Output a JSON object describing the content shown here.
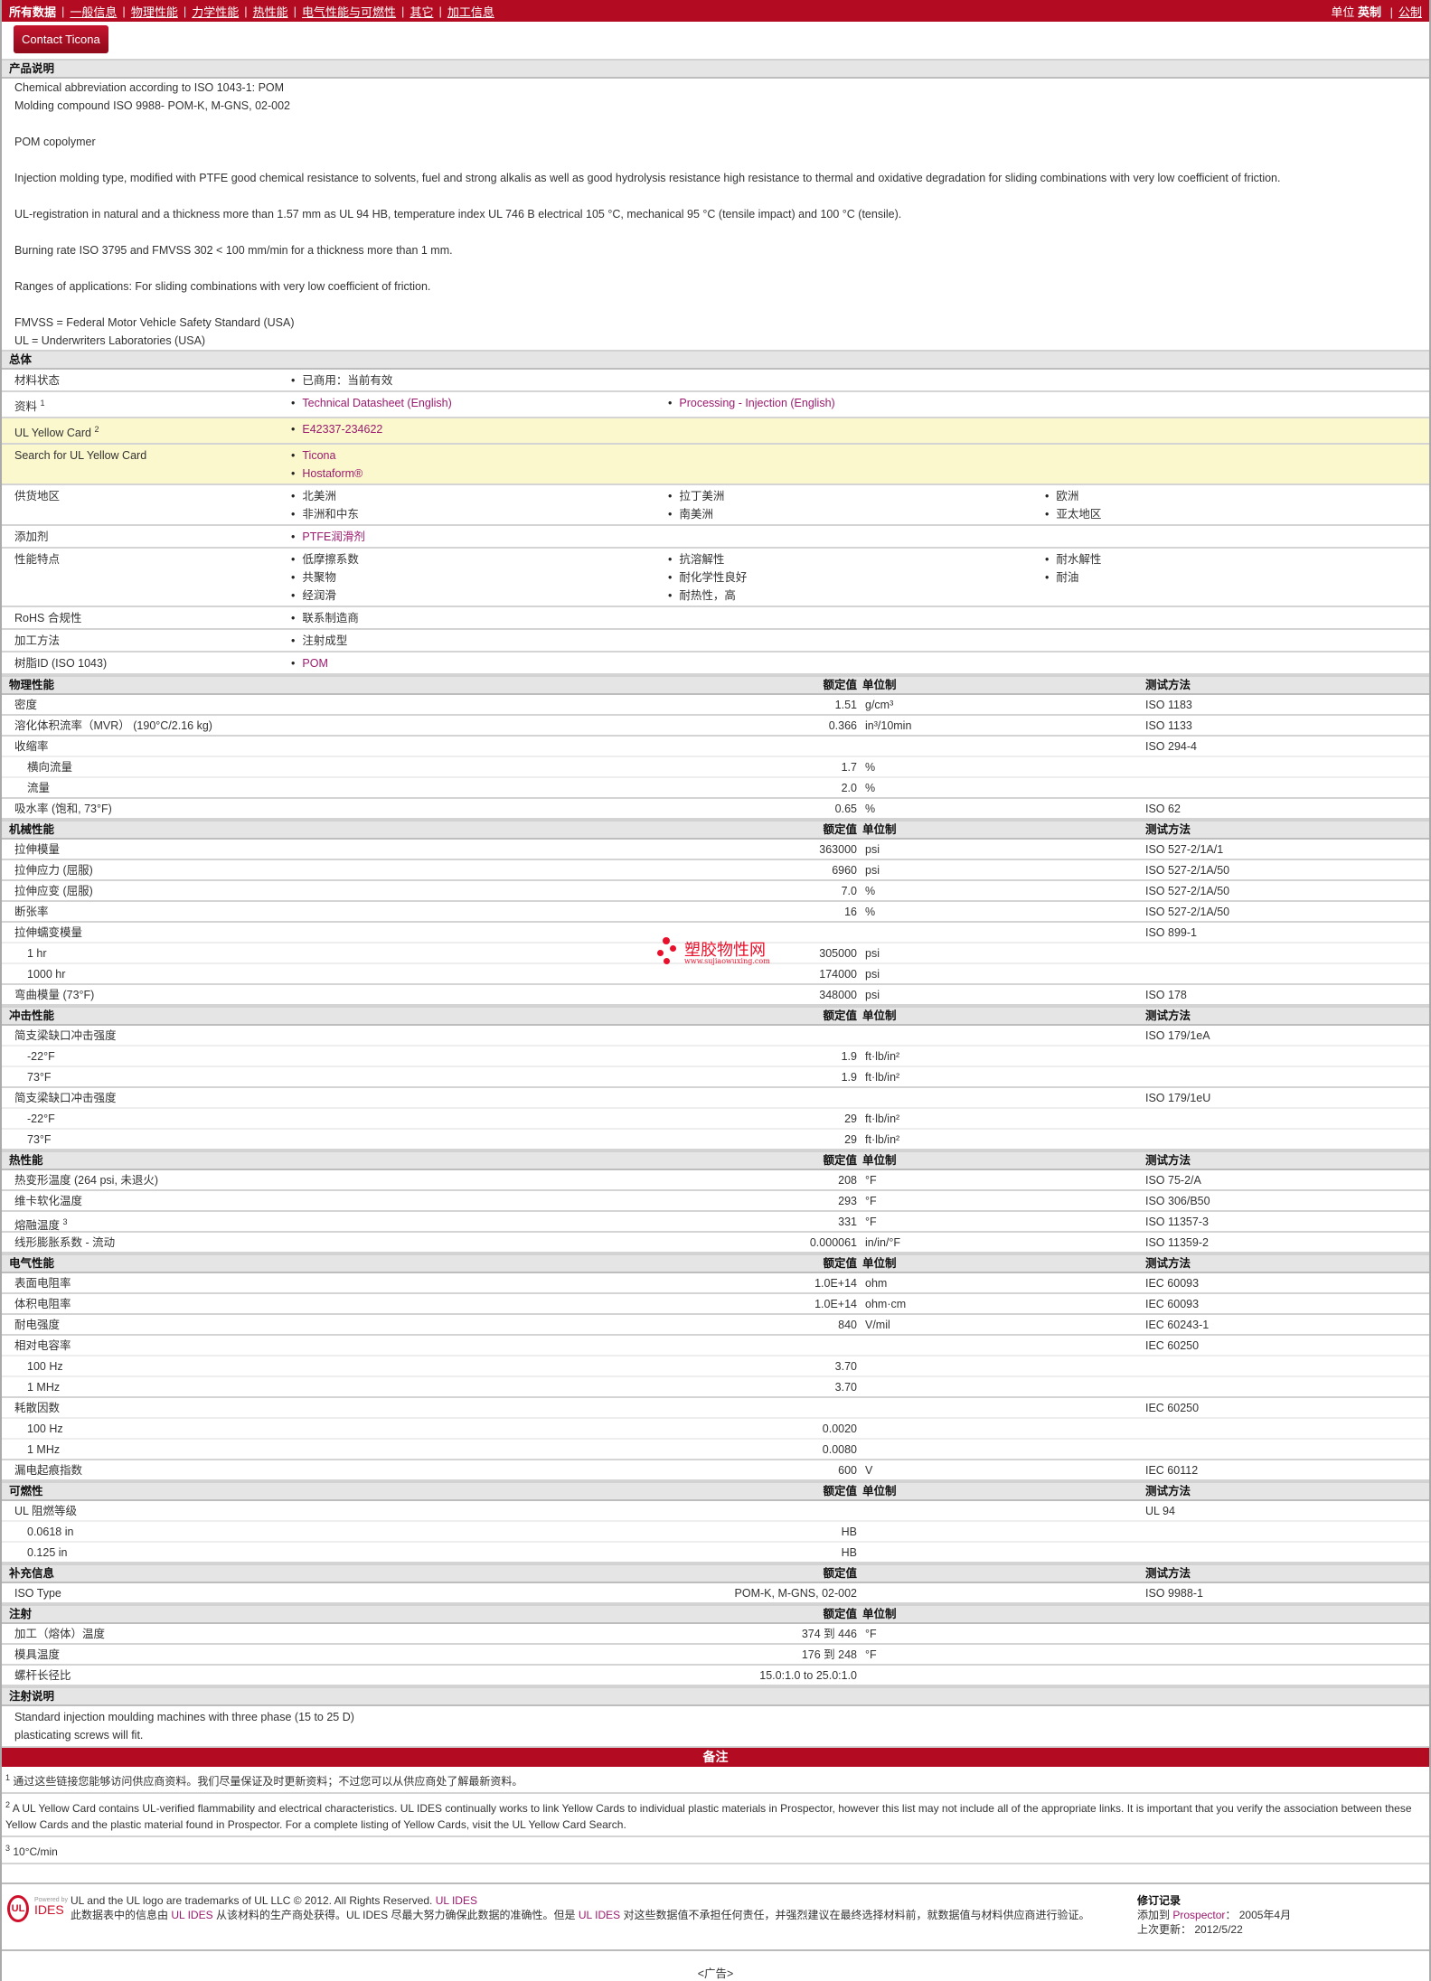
{
  "nav": {
    "items": [
      "所有数据",
      "一般信息",
      "物理性能",
      "力学性能",
      "热性能",
      "电气性能与可燃性",
      "其它",
      "加工信息"
    ],
    "units_label": "单位",
    "unit_english": "英制",
    "unit_metric": "公制"
  },
  "contact_button": "Contact Ticona",
  "description": {
    "title": "产品说明",
    "lines": [
      "Chemical abbreviation according to ISO 1043-1: POM",
      "Molding compound ISO 9988- POM-K, M-GNS, 02-002",
      "",
      "POM copolymer",
      "",
      "Injection molding type, modified with PTFE good chemical resistance to solvents, fuel and strong alkalis as well as good hydrolysis resistance high resistance to thermal and oxidative degradation for sliding combinations with very low coefficient of friction.",
      "",
      "UL-registration in natural and a thickness more than 1.57 mm as UL 94 HB, temperature index UL 746 B electrical 105 °C, mechanical 95 °C (tensile impact) and 100 °C (tensile).",
      "",
      "Burning rate ISO 3795 and FMVSS 302 < 100 mm/min for a thickness more than 1 mm.",
      "",
      "Ranges of applications: For sliding combinations with very low coefficient of friction.",
      "",
      "FMVSS = Federal Motor Vehicle Safety Standard (USA)",
      "UL = Underwriters Laboratories (USA)"
    ]
  },
  "general": {
    "title": "总体",
    "rows": [
      {
        "label": "材料状态",
        "columns": [
          [
            "已商用：当前有效"
          ]
        ]
      },
      {
        "label": "资料",
        "sup": "1",
        "link": true,
        "columns": [
          [
            "Technical Datasheet (English)"
          ],
          [
            "Processing - Injection (English)"
          ]
        ]
      },
      {
        "label": "UL Yellow Card",
        "sup": "2",
        "highlight": true,
        "link": true,
        "columns": [
          [
            "E42337-234622"
          ]
        ]
      },
      {
        "label": "Search for UL Yellow Card",
        "highlight": true,
        "link": true,
        "columns": [
          [
            "Ticona",
            "Hostaform®"
          ]
        ]
      },
      {
        "label": "供货地区",
        "columns": [
          [
            "北美洲",
            "非洲和中东"
          ],
          [
            "拉丁美洲",
            "南美洲"
          ],
          [
            "欧洲",
            "亚太地区"
          ]
        ]
      },
      {
        "label": "添加剂",
        "link": true,
        "columns": [
          [
            "PTFE润滑剂"
          ]
        ]
      },
      {
        "label": "性能特点",
        "columns": [
          [
            "低摩擦系数",
            "共聚物",
            "经润滑"
          ],
          [
            "抗溶解性",
            "耐化学性良好",
            "耐热性，高"
          ],
          [
            "耐水解性",
            "耐油"
          ]
        ]
      },
      {
        "label": "RoHS 合规性",
        "columns": [
          [
            "联系制造商"
          ]
        ]
      },
      {
        "label": "加工方法",
        "columns": [
          [
            "注射成型"
          ]
        ]
      },
      {
        "label": "树脂ID (ISO 1043)",
        "link": true,
        "columns": [
          [
            "POM"
          ]
        ]
      }
    ]
  },
  "property_sections": [
    {
      "title": "物理性能",
      "head_value": "额定值",
      "head_unit": "单位制",
      "head_method": "测试方法",
      "rows": [
        {
          "label": "密度",
          "value": "1.51",
          "unit": "g/cm³",
          "method": "ISO 1183"
        },
        {
          "label": "溶化体积流率（MVR） (190°C/2.16 kg)",
          "value": "0.366",
          "unit": "in³/10min",
          "method": "ISO 1133"
        },
        {
          "label": "收缩率",
          "value": "",
          "unit": "",
          "method": "ISO 294-4",
          "parent": true
        },
        {
          "label": "横向流量",
          "value": "1.7",
          "unit": "%",
          "method": "",
          "indent": true,
          "parent": true
        },
        {
          "label": "流量",
          "value": "2.0",
          "unit": "%",
          "method": "",
          "indent": true
        },
        {
          "label": "吸水率 (饱和, 73°F)",
          "value": "0.65",
          "unit": "%",
          "method": "ISO 62"
        }
      ]
    },
    {
      "title": "机械性能",
      "head_value": "额定值",
      "head_unit": "单位制",
      "head_method": "测试方法",
      "rows": [
        {
          "label": "拉伸模量",
          "value": "363000",
          "unit": "psi",
          "method": "ISO 527-2/1A/1"
        },
        {
          "label": "拉伸应力 (屈服)",
          "value": "6960",
          "unit": "psi",
          "method": "ISO 527-2/1A/50"
        },
        {
          "label": "拉伸应变 (屈服)",
          "value": "7.0",
          "unit": "%",
          "method": "ISO 527-2/1A/50"
        },
        {
          "label": "断张率",
          "value": "16",
          "unit": "%",
          "method": "ISO 527-2/1A/50"
        },
        {
          "label": "拉伸蠕变模量",
          "value": "",
          "unit": "",
          "method": "ISO 899-1",
          "parent": true
        },
        {
          "label": "1 hr",
          "value": "305000",
          "unit": "psi",
          "method": "",
          "indent": true,
          "parent": true
        },
        {
          "label": "1000 hr",
          "value": "174000",
          "unit": "psi",
          "method": "",
          "indent": true
        },
        {
          "label": "弯曲模量 (73°F)",
          "value": "348000",
          "unit": "psi",
          "method": "ISO 178"
        }
      ]
    },
    {
      "title": "冲击性能",
      "head_value": "额定值",
      "head_unit": "单位制",
      "head_method": "测试方法",
      "rows": [
        {
          "label": "简支梁缺口冲击强度",
          "value": "",
          "unit": "",
          "method": "ISO 179/1eA",
          "parent": true
        },
        {
          "label": "-22°F",
          "value": "1.9",
          "unit": "ft·lb/in²",
          "method": "",
          "indent": true,
          "parent": true
        },
        {
          "label": "73°F",
          "value": "1.9",
          "unit": "ft·lb/in²",
          "method": "",
          "indent": true
        },
        {
          "label": "简支梁缺口冲击强度",
          "value": "",
          "unit": "",
          "method": "ISO 179/1eU",
          "parent": true
        },
        {
          "label": "-22°F",
          "value": "29",
          "unit": "ft·lb/in²",
          "method": "",
          "indent": true,
          "parent": true
        },
        {
          "label": "73°F",
          "value": "29",
          "unit": "ft·lb/in²",
          "method": "",
          "indent": true
        }
      ]
    },
    {
      "title": "热性能",
      "head_value": "额定值",
      "head_unit": "单位制",
      "head_method": "测试方法",
      "rows": [
        {
          "label": "热变形温度 (264 psi, 未退火)",
          "value": "208",
          "unit": "°F",
          "method": "ISO 75-2/A"
        },
        {
          "label": "维卡软化温度",
          "value": "293",
          "unit": "°F",
          "method": "ISO 306/B50"
        },
        {
          "label": "熔融温度",
          "sup": "3",
          "value": "331",
          "unit": "°F",
          "method": "ISO 11357-3"
        },
        {
          "label": "线形膨胀系数 - 流动",
          "value": "0.000061",
          "unit": "in/in/°F",
          "method": "ISO 11359-2"
        }
      ]
    },
    {
      "title": "电气性能",
      "head_value": "额定值",
      "head_unit": "单位制",
      "head_method": "测试方法",
      "rows": [
        {
          "label": "表面电阻率",
          "value": "1.0E+14",
          "unit": "ohm",
          "method": "IEC 60093"
        },
        {
          "label": "体积电阻率",
          "value": "1.0E+14",
          "unit": "ohm·cm",
          "method": "IEC 60093"
        },
        {
          "label": "耐电强度",
          "value": "840",
          "unit": "V/mil",
          "method": "IEC 60243-1"
        },
        {
          "label": "相对电容率",
          "value": "",
          "unit": "",
          "method": "IEC 60250",
          "parent": true
        },
        {
          "label": "100 Hz",
          "value": "3.70",
          "unit": "",
          "method": "",
          "indent": true,
          "parent": true
        },
        {
          "label": "1 MHz",
          "value": "3.70",
          "unit": "",
          "method": "",
          "indent": true
        },
        {
          "label": "耗散因数",
          "value": "",
          "unit": "",
          "method": "IEC 60250",
          "parent": true
        },
        {
          "label": "100 Hz",
          "value": "0.0020",
          "unit": "",
          "method": "",
          "indent": true,
          "parent": true
        },
        {
          "label": "1 MHz",
          "value": "0.0080",
          "unit": "",
          "method": "",
          "indent": true
        },
        {
          "label": "漏电起痕指数",
          "value": "600",
          "unit": "V",
          "method": "IEC 60112"
        }
      ]
    },
    {
      "title": "可燃性",
      "head_value": "额定值",
      "head_unit": "单位制",
      "head_method": "测试方法",
      "rows": [
        {
          "label": "UL 阻燃等级",
          "value": "",
          "unit": "",
          "method": "UL 94",
          "parent": true
        },
        {
          "label": "0.0618 in",
          "value": "HB",
          "unit": "",
          "method": "",
          "indent": true,
          "parent": true
        },
        {
          "label": "0.125 in",
          "value": "HB",
          "unit": "",
          "method": "",
          "indent": true
        }
      ]
    },
    {
      "title": "补充信息",
      "head_value": "额定值",
      "head_unit": "",
      "head_method": "测试方法",
      "rows": [
        {
          "label": "ISO Type",
          "value": "POM-K, M-GNS, 02-002",
          "unit": "",
          "method": "ISO 9988-1"
        }
      ]
    },
    {
      "title": "注射",
      "head_value": "额定值",
      "head_unit": "单位制",
      "head_method": "",
      "rows": [
        {
          "label": "加工（熔体）温度",
          "value": "374 到 446",
          "unit": "°F",
          "method": ""
        },
        {
          "label": "模具温度",
          "value": "176 到 248",
          "unit": "°F",
          "method": ""
        },
        {
          "label": "螺杆长径比",
          "value": "15.0:1.0 to 25.0:1.0",
          "unit": "",
          "method": ""
        }
      ]
    }
  ],
  "injection_notes": {
    "title": "注射说明",
    "lines": [
      "Standard injection moulding machines with three phase (15 to 25 D)",
      "plasticating screws will fit."
    ]
  },
  "notes": {
    "title": "备注",
    "items": [
      {
        "sup": "1",
        "text": "通过这些链接您能够访问供应商资料。我们尽量保证及时更新资料；不过您可以从供应商处了解最新资料。"
      },
      {
        "sup": "2",
        "text": "A UL Yellow Card contains UL-verified flammability and electrical characteristics. UL IDES continually works to link Yellow Cards to individual plastic materials in Prospector, however this list may not include all of the appropriate links. It is important that you verify the association between these Yellow Cards and the plastic material found in Prospector. For a complete listing of Yellow Cards, visit the UL Yellow Card Search."
      },
      {
        "sup": "3",
        "text": "10°C/min"
      }
    ]
  },
  "footer": {
    "logo": {
      "powered_by": "Powered by",
      "ul": "UL",
      "ides": "IDES"
    },
    "trademark": "UL and the UL logo are trademarks of UL LLC © 2012. All Rights Reserved.",
    "ides_link": "UL IDES",
    "disclaimer_1": "此数据表中的信息由",
    "disclaimer_link_1": "UL IDES",
    "disclaimer_2": "从该材料的生产商处获得。UL IDES 尽最大努力确保此数据的准确性。但是",
    "disclaimer_link_2": "UL IDES",
    "disclaimer_3": "对这些数据值不承担任何责任，并强烈建议在最终选择材料前，就数据值与材料供应商进行验证。",
    "revision_title": "修订记录",
    "added_label": "添加到",
    "added_link": "Prospector",
    "added_value": "：  2005年4月",
    "updated_label": "上次更新：",
    "updated_value": "2012/5/22"
  },
  "watermark": {
    "title": "塑胶物性网",
    "url": "www.sujiaowuxing.com"
  },
  "ad_label": "<广告>"
}
